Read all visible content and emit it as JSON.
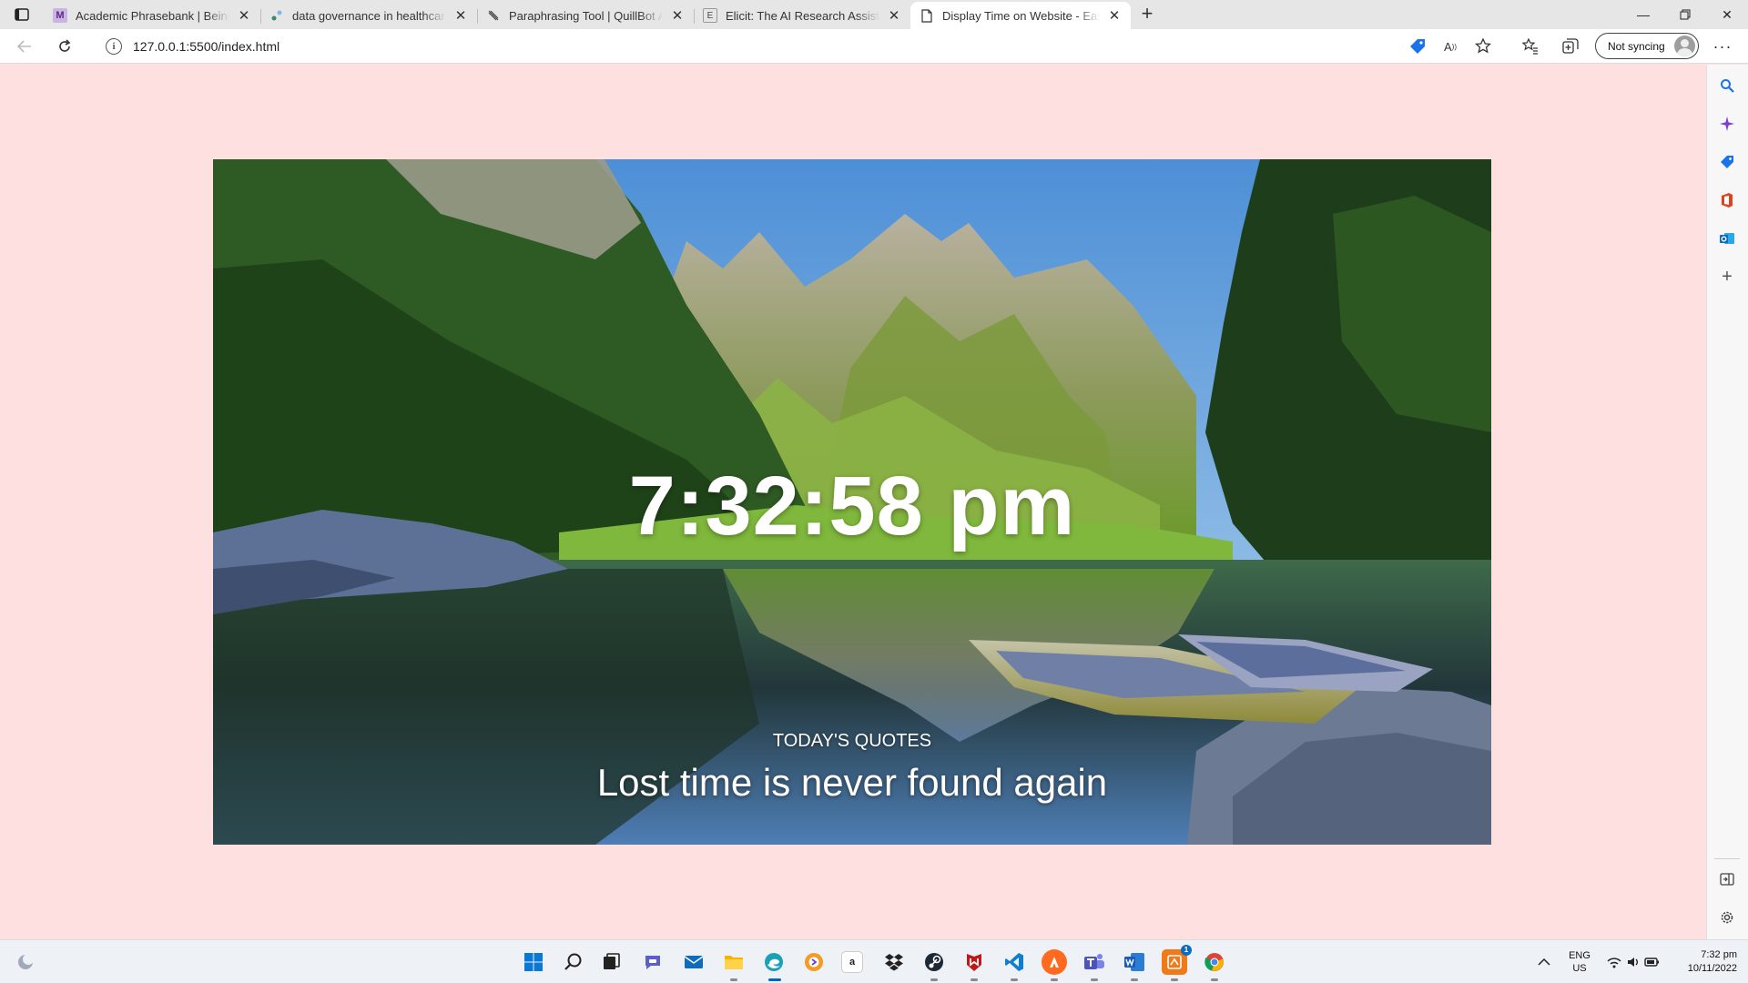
{
  "browser": {
    "tabs": [
      {
        "title": "Academic Phrasebank | Being ca",
        "favicon": "m-letter-icon",
        "active": false
      },
      {
        "title": "data governance in healthcare |",
        "favicon": "link-favicon",
        "active": false
      },
      {
        "title": "Paraphrasing Tool | QuillBot AI",
        "favicon": "quillbot-feather-icon",
        "active": false
      },
      {
        "title": "Elicit: The AI Research Assistant",
        "favicon": "e-letter-icon",
        "active": false
      },
      {
        "title": "Display Time on Website - Easy T",
        "favicon": "document-icon",
        "active": true
      }
    ],
    "address": {
      "url": "127.0.0.1:5500/index.html"
    },
    "profile": {
      "sync_label": "Not syncing"
    }
  },
  "page": {
    "background_color": "#ffe0e0",
    "clock_text": "7:32:58 pm",
    "quote_label": "TODAY'S QUOTES",
    "quote_text": "Lost time is never found again"
  },
  "taskbar": {
    "apps": [
      "start-icon",
      "search-icon",
      "task-view-icon",
      "chat-icon",
      "mail-icon",
      "file-explorer-icon",
      "edge-icon",
      "opera-icon",
      "amazon-icon",
      "dropbox-icon",
      "steam-icon",
      "mcafee-icon",
      "vscode-icon",
      "avast-icon",
      "teams-icon",
      "word-icon",
      "office-icon",
      "chrome-icon"
    ],
    "tray": {
      "lang_line1": "ENG",
      "lang_line2": "US",
      "time": "7:32 pm",
      "date": "10/11/2022"
    }
  }
}
